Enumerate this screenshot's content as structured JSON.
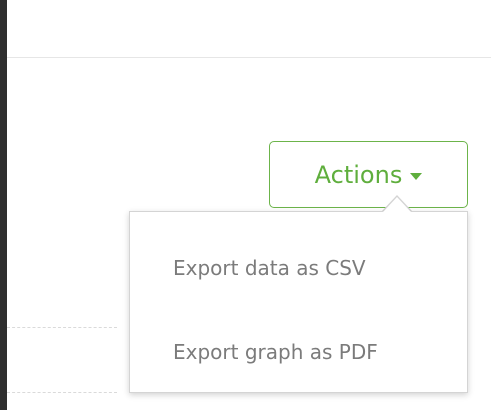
{
  "actions_button": {
    "label": "Actions"
  },
  "actions_menu": {
    "items": [
      {
        "label": "Export data as CSV"
      },
      {
        "label": "Export graph as PDF"
      }
    ]
  },
  "colors": {
    "accent": "#5fae3d",
    "menu_text": "#7b7b7b",
    "border": "#d4d4d4"
  },
  "icons": {
    "caret": "chevron-down-icon"
  }
}
